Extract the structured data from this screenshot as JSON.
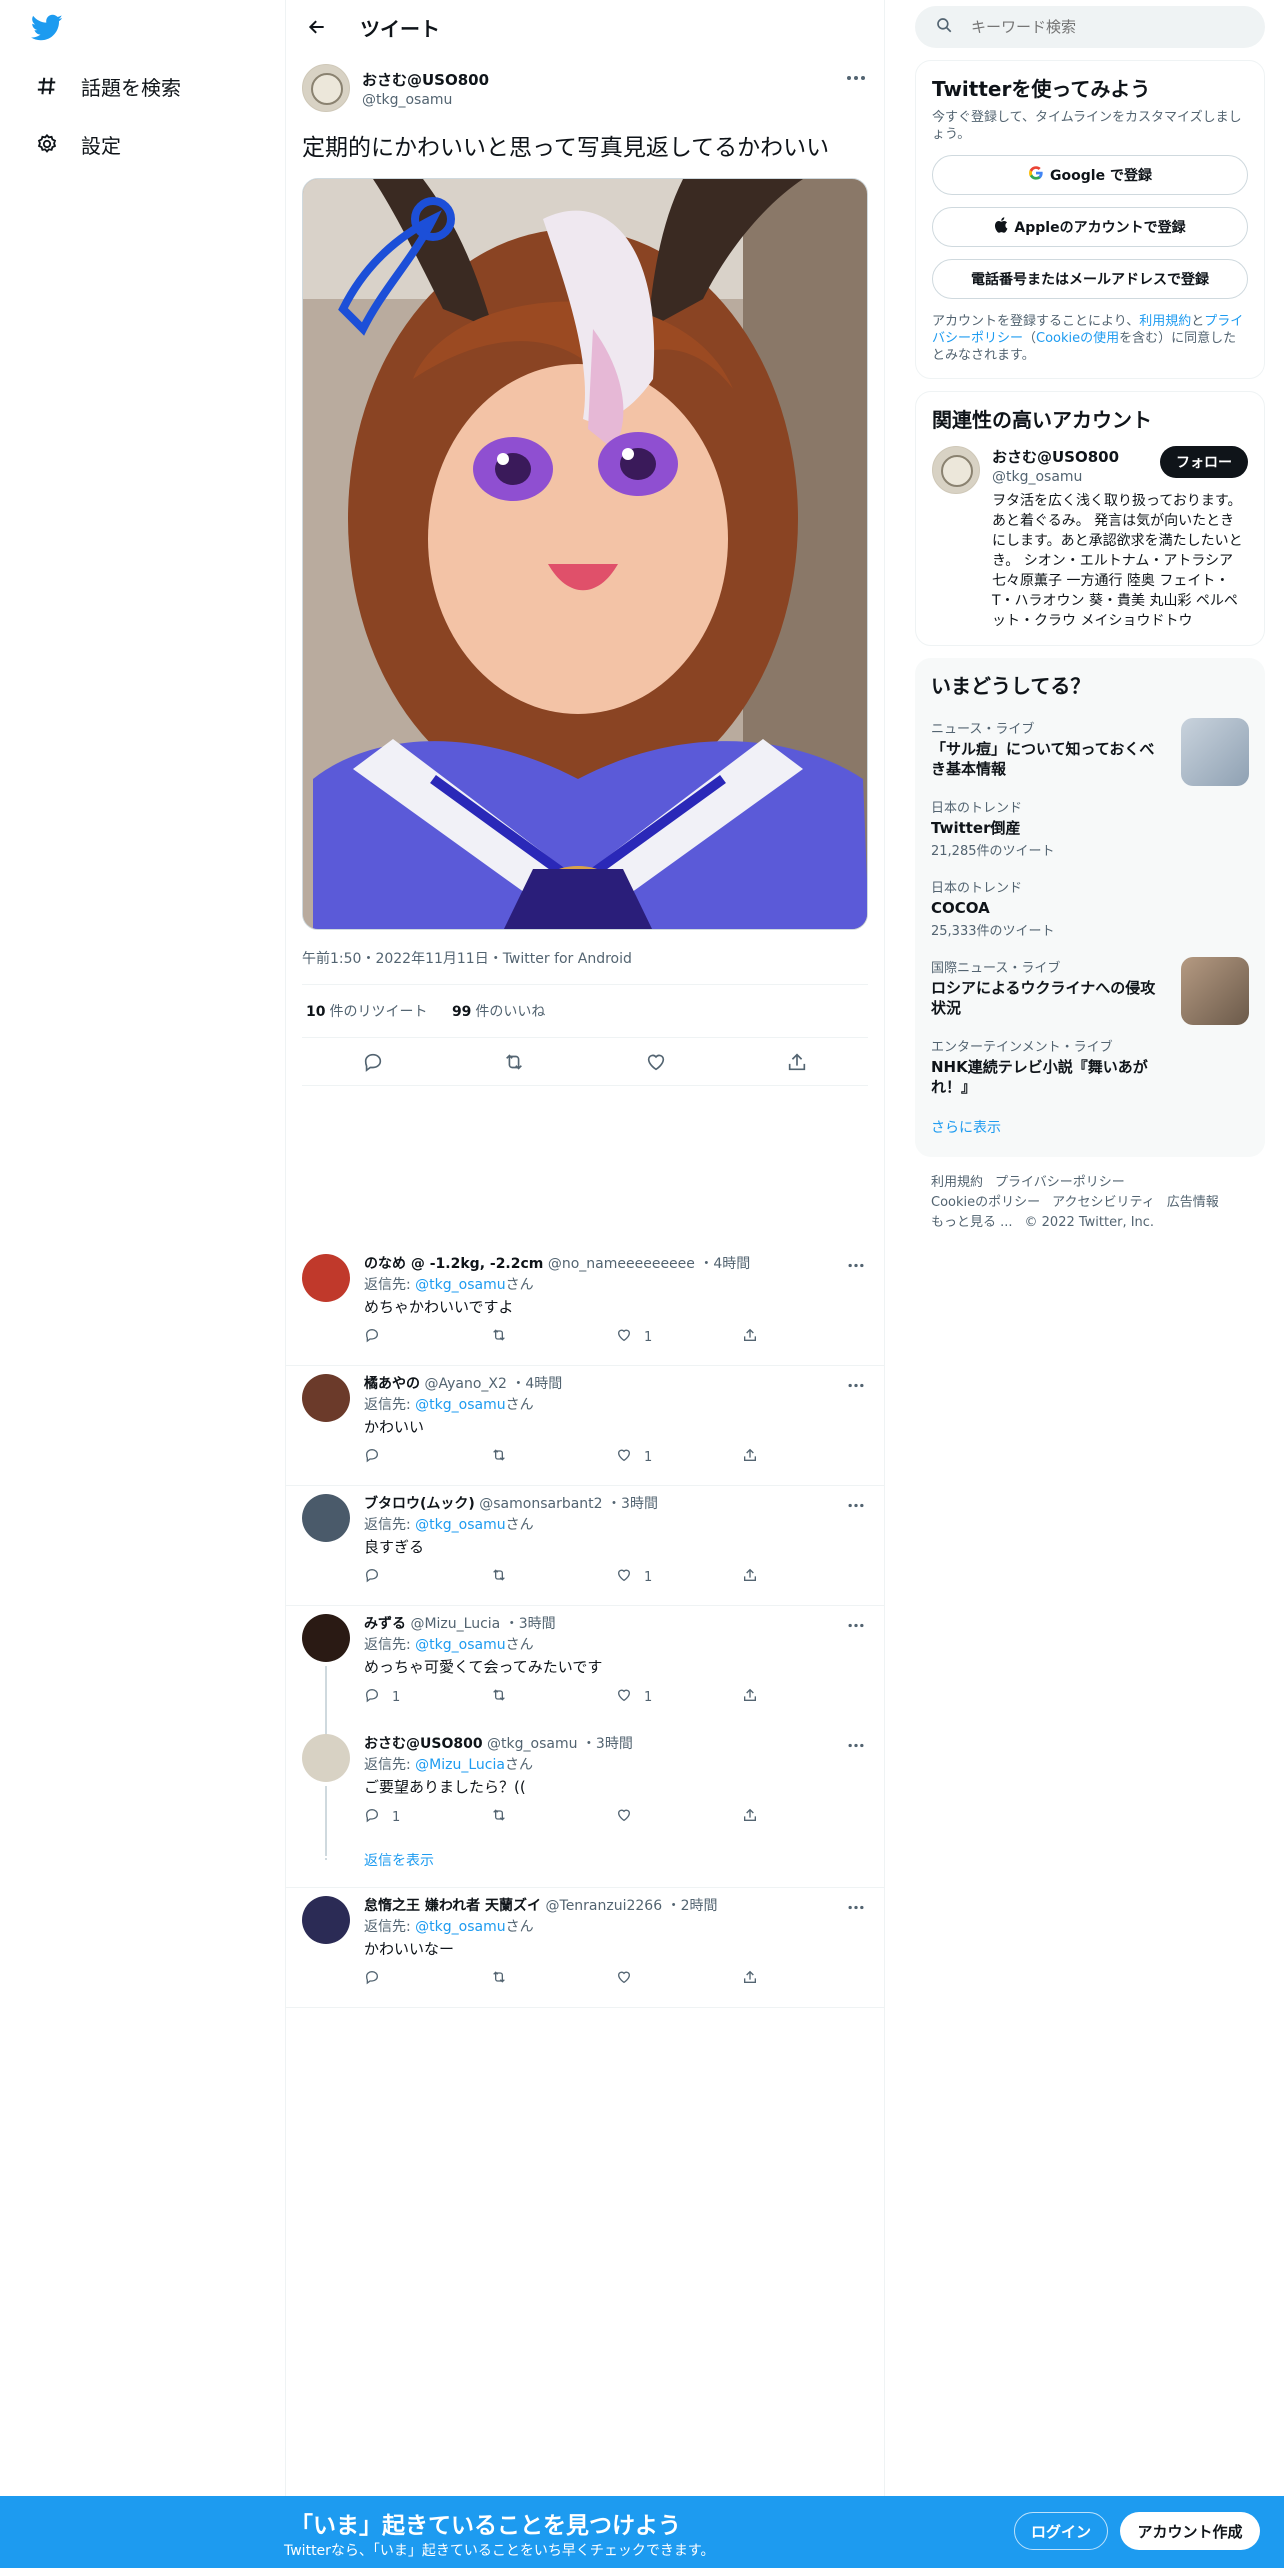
{
  "nav": {
    "logo_icon": "twitter-bird-icon",
    "items": [
      {
        "label": "話題を検索",
        "icon": "hashtag-icon"
      },
      {
        "label": "設定",
        "icon": "gear-icon"
      }
    ]
  },
  "header": {
    "title": "ツイート"
  },
  "tweet": {
    "name": "おさむ@USO800",
    "handle": "@tkg_osamu",
    "text": "定期的にかわいいと思って写真見返してるかわいい",
    "meta": "午前1:50・2022年11月11日・Twitter for Android",
    "retweets_count": "10",
    "retweets_label": "件のリツイート",
    "likes_count": "99",
    "likes_label": "件のいいね"
  },
  "replies": [
    {
      "name": "のなめ @ -1.2kg, -2.2cm",
      "handle": "@no_nameeeeeeeee",
      "time": "・4時間",
      "replyto_prefix": "返信先: ",
      "replyto": "@tkg_osamu",
      "replyto_suffix": "さん",
      "text": "めちゃかわいいですよ",
      "reply_count": "",
      "retweet_count": "",
      "like_count": "1"
    },
    {
      "name": "橘あやの",
      "handle": "@Ayano_X2",
      "time": "・4時間",
      "replyto_prefix": "返信先: ",
      "replyto": "@tkg_osamu",
      "replyto_suffix": "さん",
      "text": "かわいい",
      "reply_count": "",
      "retweet_count": "",
      "like_count": "1"
    },
    {
      "name": "ブタロウ(ムック)",
      "handle": "@samonsarbant2",
      "time": "・3時間",
      "replyto_prefix": "返信先: ",
      "replyto": "@tkg_osamu",
      "replyto_suffix": "さん",
      "text": "良すぎる",
      "reply_count": "",
      "retweet_count": "",
      "like_count": "1"
    },
    {
      "name": "みずる",
      "handle": "@Mizu_Lucia",
      "time": "・3時間",
      "replyto_prefix": "返信先: ",
      "replyto": "@tkg_osamu",
      "replyto_suffix": "さん",
      "text": "めっちゃ可愛くて会ってみたいです",
      "reply_count": "1",
      "retweet_count": "",
      "like_count": "1"
    },
    {
      "name": "おさむ@USO800",
      "handle": "@tkg_osamu",
      "time": "・3時間",
      "replyto_prefix": "返信先: ",
      "replyto": "@Mizu_Lucia",
      "replyto_suffix": "さん",
      "text": "ご要望ありましたら？((",
      "reply_count": "1",
      "retweet_count": "",
      "like_count": ""
    },
    {
      "name": "怠惰之王 嫌われ者 天蘭ズイ",
      "handle": "@Tenranzui2266",
      "time": "・2時間",
      "replyto_prefix": "返信先: ",
      "replyto": "@tkg_osamu",
      "replyto_suffix": "さん",
      "text": "かわいいなー",
      "reply_count": "",
      "retweet_count": "",
      "like_count": ""
    }
  ],
  "show_replies": "返信を表示",
  "search": {
    "placeholder": "キーワード検索"
  },
  "signup_panel": {
    "title": "Twitterを使ってみよう",
    "subtitle": "今すぐ登録して、タイムラインをカスタマイズしましょう。",
    "google": "Google で登録",
    "apple": "Appleのアカウントで登録",
    "phone": "電話番号またはメールアドレスで登録",
    "legal_1": "アカウントを登録することにより、",
    "legal_terms": "利用規約",
    "legal_2": "と",
    "legal_privacy": "プライバシーポリシー",
    "legal_3": "（",
    "legal_cookie": "Cookieの使用",
    "legal_4": "を含む）に同意したとみなされます。"
  },
  "related": {
    "title": "関連性の高いアカウント",
    "name": "おさむ@USO800",
    "handle": "@tkg_osamu",
    "follow": "フォロー",
    "bio": "ヲタ活を広く浅く取り扱っております。 あと着ぐるみ。 発言は気が向いたときにします。あと承認欲求を満たしたいとき。 シオン・エルトナム・アトラシア 七々原薫子 一方通行 陸奥 フェイト・T・ハラオウン 葵・貴美 丸山彩 ペルペット・クラウ メイショウドトウ"
  },
  "trends": {
    "title": "いまどうしてる？",
    "items": [
      {
        "category": "ニュース・ライブ",
        "title": "「サル痘」について知っておくべき基本情報",
        "count": "",
        "has_image": true
      },
      {
        "category": "日本のトレンド",
        "title": "Twitter倒産",
        "count": "21,285件のツイート",
        "has_image": false
      },
      {
        "category": "日本のトレンド",
        "title": "COCOA",
        "count": "25,333件のツイート",
        "has_image": false
      },
      {
        "category": "国際ニュース・ライブ",
        "title": "ロシアによるウクライナへの侵攻状況",
        "count": "",
        "has_image": true
      },
      {
        "category": "エンターテインメント・ライブ",
        "title": "NHK連続テレビ小説『舞いあがれ！』",
        "count": "",
        "has_image": false
      }
    ],
    "show_more": "さらに表示"
  },
  "footer": {
    "line1": [
      "利用規約",
      "プライバシーポリシー"
    ],
    "line2": [
      "Cookieのポリシー",
      "アクセシビリティ",
      "広告情報"
    ],
    "more": "もっと見る ...",
    "copyright": "© 2022 Twitter, Inc."
  },
  "bottom_bar": {
    "title": "「いま」起きていることを見つけよう",
    "subtitle": "Twitterなら、「いま」起きていることをいち早くチェックできます。",
    "login": "ログイン",
    "signup": "アカウント作成"
  },
  "colors": {
    "accent": "#1d9bf0",
    "text": "#0f1419",
    "muted": "#536471",
    "border": "#eff3f4"
  }
}
